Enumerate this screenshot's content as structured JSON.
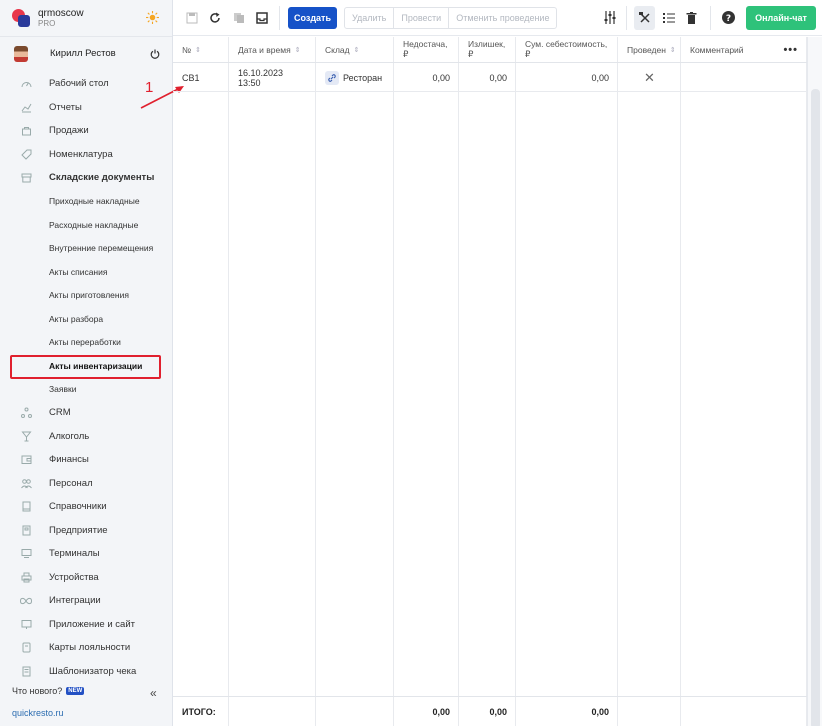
{
  "brand": {
    "name": "qrmoscow",
    "plan": "PRO"
  },
  "user": {
    "name": "Кирилл Рестов"
  },
  "nav": {
    "items": [
      {
        "label": "Рабочий стол",
        "icon": "gauge-icon"
      },
      {
        "label": "Отчеты",
        "icon": "chart-icon"
      },
      {
        "label": "Продажи",
        "icon": "basket-icon"
      },
      {
        "label": "Номенклатура",
        "icon": "tag-icon"
      },
      {
        "label": "Складские документы",
        "icon": "box-icon"
      }
    ],
    "sub": [
      "Приходные накладные",
      "Расходные накладные",
      "Внутренние перемещения",
      "Акты списания",
      "Акты приготовления",
      "Акты разбора",
      "Акты переработки",
      "Акты инвентаризации",
      "Заявки"
    ],
    "items2": [
      {
        "label": "CRM",
        "icon": "crm-icon"
      },
      {
        "label": "Алкоголь",
        "icon": "glass-icon"
      },
      {
        "label": "Финансы",
        "icon": "wallet-icon"
      },
      {
        "label": "Персонал",
        "icon": "people-icon"
      },
      {
        "label": "Справочники",
        "icon": "book-icon"
      },
      {
        "label": "Предприятие",
        "icon": "building-icon"
      },
      {
        "label": "Терминалы",
        "icon": "terminal-icon"
      },
      {
        "label": "Устройства",
        "icon": "printer-icon"
      },
      {
        "label": "Интеграции",
        "icon": "infinity-icon"
      },
      {
        "label": "Приложение и сайт",
        "icon": "monitor-icon"
      },
      {
        "label": "Карты лояльности",
        "icon": "card-icon"
      },
      {
        "label": "Шаблонизатор чека",
        "icon": "receipt-icon"
      }
    ]
  },
  "whats_new": {
    "label": "Что нового?",
    "badge": "NEW"
  },
  "footer_link": "quickresto.ru",
  "toolbar": {
    "create": "Создать",
    "delete": "Удалить",
    "post": "Провести",
    "unpost": "Отменить проведение",
    "chat": "Онлайн-чат"
  },
  "table": {
    "headers": {
      "num": "№",
      "date": "Дата и время",
      "store": "Склад",
      "shortage": "Недостача, ₽",
      "surplus": "Излишек, ₽",
      "cost": "Сум. себестоимость, ₽",
      "posted": "Проведен",
      "comment": "Комментарий"
    },
    "rows": [
      {
        "num": "СВ1",
        "date": "16.10.2023 13:50",
        "store": "Ресторан",
        "shortage": "0,00",
        "surplus": "0,00",
        "cost": "0,00",
        "posted": "✕",
        "comment": ""
      }
    ],
    "footer": {
      "label": "ИТОГО:",
      "shortage": "0,00",
      "surplus": "0,00",
      "cost": "0,00"
    }
  },
  "annotation": {
    "label": "1",
    "color": "#e0202e"
  }
}
